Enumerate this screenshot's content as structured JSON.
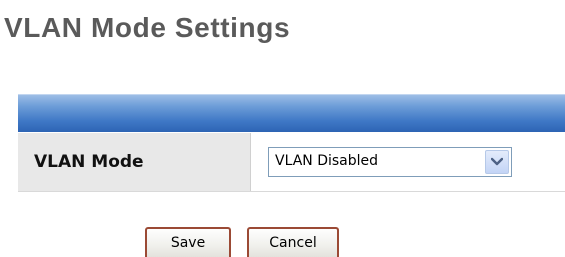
{
  "page": {
    "title": "VLAN Mode Settings"
  },
  "settings": {
    "vlan_mode_label": "VLAN Mode",
    "vlan_mode_value": "VLAN Disabled"
  },
  "buttons": {
    "save_label": "Save",
    "cancel_label": "Cancel"
  },
  "icons": {
    "dropdown": "chevron-down-icon"
  },
  "colors": {
    "title": "#5a5a5a",
    "header_bar": "#3f78c6",
    "label_cell": "#e8e8e8",
    "button_border": "#9b4a35"
  }
}
